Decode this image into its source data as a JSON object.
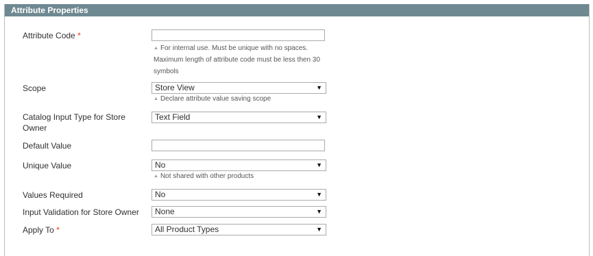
{
  "header": {
    "title": "Attribute Properties"
  },
  "fields": {
    "attribute_code": {
      "label": "Attribute Code",
      "required_mark": "*",
      "value": "",
      "note_lines": [
        "For internal use. Must be unique with no spaces.",
        "Maximum length of attribute code must be less then 30",
        "symbols"
      ]
    },
    "scope": {
      "label": "Scope",
      "value": "Store View",
      "note": "Declare attribute value saving scope"
    },
    "input_type": {
      "label_lines": [
        "Catalog Input Type for Store",
        "Owner"
      ],
      "value": "Text Field"
    },
    "default_value": {
      "label": "Default Value",
      "value": ""
    },
    "unique_value": {
      "label": "Unique Value",
      "value": "No",
      "note": "Not shared with other products"
    },
    "values_required": {
      "label": "Values Required",
      "value": "No"
    },
    "input_validation": {
      "label": "Input Validation for Store Owner",
      "value": "None"
    },
    "apply_to": {
      "label": "Apply To",
      "required_mark": "*",
      "value": "All Product Types"
    }
  },
  "icons": {
    "dropdown": "▼",
    "note_marker": "▲"
  }
}
